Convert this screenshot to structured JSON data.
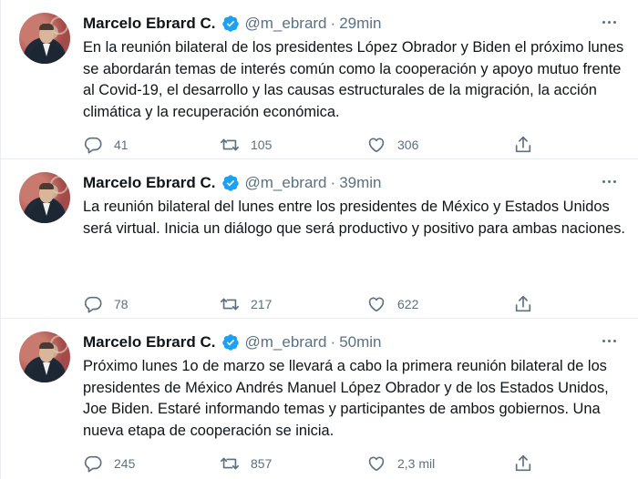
{
  "colors": {
    "text": "#0f1419",
    "secondary": "#5b7083",
    "verified": "#1da1f2",
    "border": "#ebeef0"
  },
  "tweets": [
    {
      "name": "Marcelo Ebrard C.",
      "handle": "@m_ebrard",
      "separator": "·",
      "time": "29min",
      "text": "En la reunión bilateral de los presidentes López Obrador y Biden  el próximo lunes se abordarán temas de interés común como la cooperación y apoyo mutuo frente al Covid-19, el desarrollo y las causas estructurales de la migración, la acción climática y la recuperación económica.",
      "replies": "41",
      "retweets": "105",
      "likes": "306"
    },
    {
      "name": "Marcelo Ebrard C.",
      "handle": "@m_ebrard",
      "separator": "·",
      "time": "39min",
      "text": "La reunión bilateral del lunes entre los presidentes de México y Estados Unidos será virtual. Inicia un diálogo que será productivo y positivo para ambas naciones.",
      "replies": "78",
      "retweets": "217",
      "likes": "622"
    },
    {
      "name": "Marcelo Ebrard C.",
      "handle": "@m_ebrard",
      "separator": "·",
      "time": "50min",
      "text": "Próximo lunes 1o de marzo se llevará a cabo la primera reunión bilateral de los presidentes de México Andrés Manuel López Obrador y de los Estados Unidos, Joe Biden. Estaré informando temas y participantes de ambos gobiernos. Una nueva etapa de cooperación se inicia.",
      "replies": "245",
      "retweets": "857",
      "likes": "2,3 mil"
    }
  ],
  "icons": {
    "more": "more-horizontal-icon",
    "verified": "verified-badge-icon",
    "reply": "reply-icon",
    "retweet": "retweet-icon",
    "like": "heart-icon",
    "share": "share-icon"
  }
}
